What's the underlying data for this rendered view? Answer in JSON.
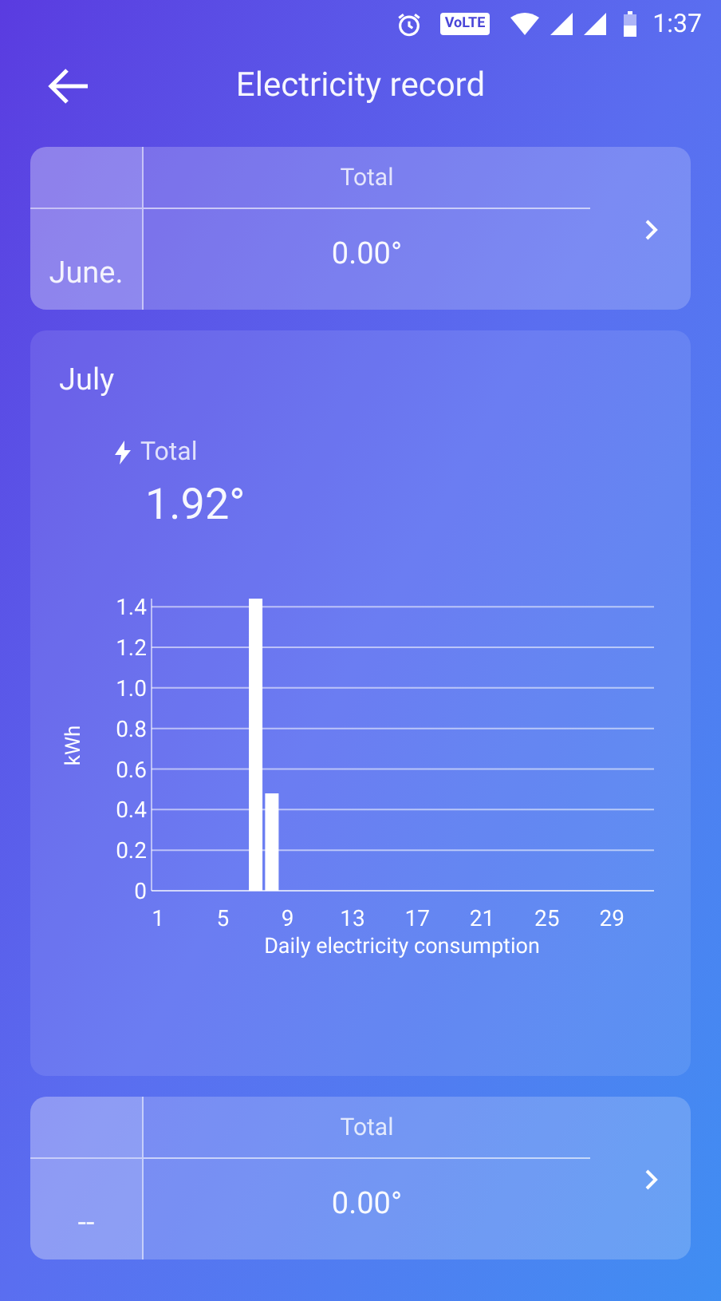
{
  "status_bar": {
    "badge": "VoLTE",
    "time": "1:37"
  },
  "header": {
    "title": "Electricity record"
  },
  "records": [
    {
      "kind": "summary",
      "month": "June.",
      "total_label": "Total",
      "value": "0.00°"
    },
    {
      "kind": "detail",
      "month": "July",
      "total_label": "Total",
      "value": "1.92°",
      "chart_data": {
        "type": "bar",
        "xlabel": "Daily electricity consumption",
        "ylabel": "kWh",
        "x": [
          1,
          2,
          3,
          4,
          5,
          6,
          7,
          8,
          9,
          10,
          11,
          12,
          13,
          14,
          15,
          16,
          17,
          18,
          19,
          20,
          21,
          22,
          23,
          24,
          25,
          26,
          27,
          28,
          29,
          30,
          31
        ],
        "values": [
          0,
          0,
          0,
          0,
          0,
          0,
          1.44,
          0.48,
          0,
          0,
          0,
          0,
          0,
          0,
          0,
          0,
          0,
          0,
          0,
          0,
          0,
          0,
          0,
          0,
          0,
          0,
          0,
          0,
          0,
          0,
          0
        ],
        "xlim": [
          0.6,
          31.6
        ],
        "ylim": [
          0,
          1.44
        ],
        "grid": true,
        "xticks": [
          1,
          5,
          9,
          13,
          17,
          21,
          25,
          29
        ],
        "yticks": [
          {
            "value": 0,
            "label": "0"
          },
          {
            "value": 0.2,
            "label": "0.2"
          },
          {
            "value": 0.4,
            "label": "0.4"
          },
          {
            "value": 0.6,
            "label": "0.6"
          },
          {
            "value": 0.8,
            "label": "0.8"
          },
          {
            "value": 1,
            "label": "1.0"
          },
          {
            "value": 1.2,
            "label": "1.2"
          },
          {
            "value": 1.4,
            "label": "1.4"
          }
        ]
      }
    },
    {
      "kind": "summary",
      "month": "--",
      "total_label": "Total",
      "value": "0.00°"
    }
  ]
}
